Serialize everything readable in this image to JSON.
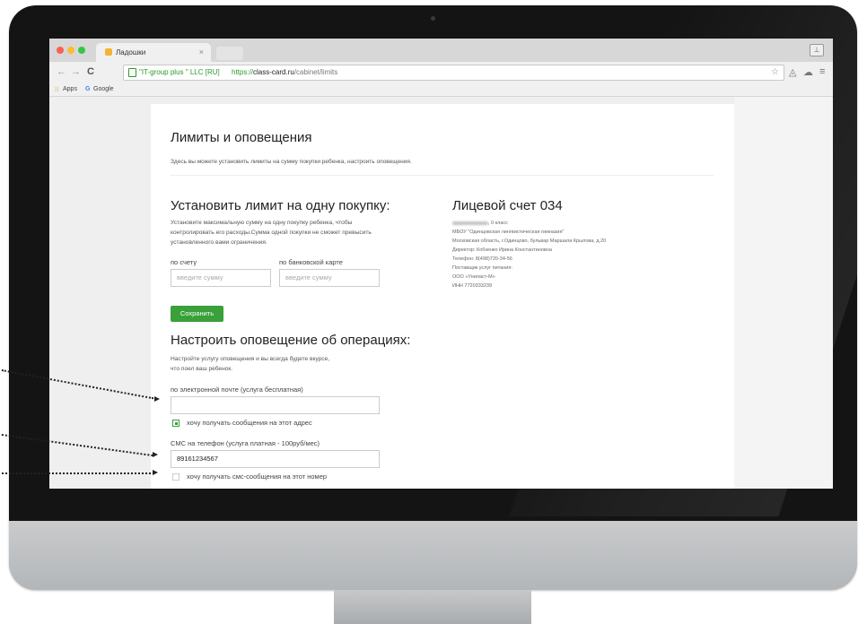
{
  "browser": {
    "tab_title": "Ладошки",
    "tab_close": "×",
    "ev_badge": "\"IT-group plus \" LLC [RU]",
    "url": {
      "protocol": "https://",
      "host": "class-card.ru",
      "path": "/cabinet/limits"
    },
    "nav": {
      "back": "←",
      "forward": "→",
      "reload": "C"
    },
    "bookmarks": [
      "Apps",
      "Google"
    ],
    "bookmark_google_icon": "G",
    "traffic_light_colors": [
      "#fc5f57",
      "#fdbc2e",
      "#33c748"
    ]
  },
  "page": {
    "title": "Лимиты и оповещения",
    "subtitle": "Здесь вы можете установить лимиты на сумму покупки ребенка, настроить оповещения.",
    "limit": {
      "heading": "Установить лимит на одну покупку:",
      "description": [
        "Установите максимальную сумму на одну покупку ребенка, чтобы",
        "контролировать его расходы.Сумма одной покупки не сможет превысить",
        "установленного вами ограничения."
      ],
      "account_label": "по счету",
      "card_label": "по банковской карте",
      "account_placeholder": "введите сумму",
      "card_placeholder": "введите сумму",
      "save_button": "Сохранить"
    },
    "account": {
      "heading": "Лицевой счет 034",
      "student_class": ", 0 класс",
      "lines": [
        "МБОУ \"Одинцовская лингвистическая гимназия\"",
        "Московская область, г.Одинцово, бульвар Маршала Крылова, д.20",
        "Директор: Кобзенко Ирина Константиновна",
        "Телефон: 8(498)720-34-56",
        "Поставщик услуг питания:",
        "ООО «Униласт-М»",
        "ИНН 7720333239"
      ]
    },
    "notify": {
      "heading": "Настроить оповещение об операциях:",
      "description": [
        "Настройте услугу оповещения и вы всегда будете вкурсе,",
        "что поел ваш ребенок."
      ],
      "email_label": "по электронной почте (услуга бесплатная)",
      "email_value": "",
      "email_checkbox_label": "хочу получать сообщения на этот адрес",
      "email_checked": true,
      "sms_label": "СМС на телефон (услуга платная - 100руб/мес)",
      "sms_value": "89161234567",
      "sms_checkbox_label": "хочу получать смс-сообщения на этот номер",
      "sms_checked": false
    }
  },
  "colors": {
    "accent_green": "#3aa03a",
    "secure_green": "#2a9a2a",
    "favicon": "#f5b335"
  }
}
